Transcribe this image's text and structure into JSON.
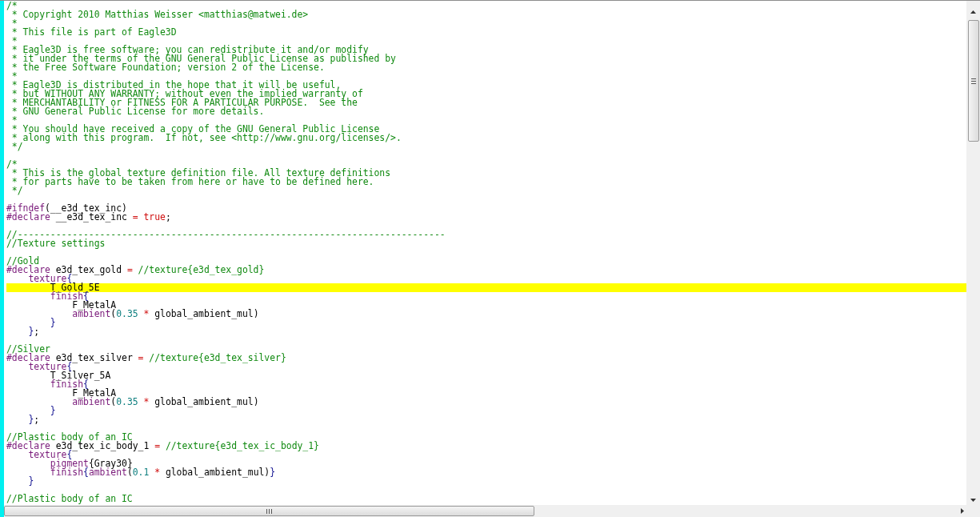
{
  "editor": {
    "lines": [
      {
        "current": false,
        "tokens": [
          {
            "kind": "comment",
            "text": "/*"
          }
        ]
      },
      {
        "current": false,
        "tokens": [
          {
            "kind": "comment",
            "text": " * Copyright 2010 Matthias Weisser <matthias@matwei.de>"
          }
        ]
      },
      {
        "current": false,
        "tokens": [
          {
            "kind": "comment",
            "text": " *"
          }
        ]
      },
      {
        "current": false,
        "tokens": [
          {
            "kind": "comment",
            "text": " * This file is part of Eagle3D"
          }
        ]
      },
      {
        "current": false,
        "tokens": [
          {
            "kind": "comment",
            "text": " *"
          }
        ]
      },
      {
        "current": false,
        "tokens": [
          {
            "kind": "comment",
            "text": " * Eagle3D is free software; you can redistribute it and/or modify"
          }
        ]
      },
      {
        "current": false,
        "tokens": [
          {
            "kind": "comment",
            "text": " * it under the terms of the GNU General Public License as published by"
          }
        ]
      },
      {
        "current": false,
        "tokens": [
          {
            "kind": "comment",
            "text": " * the Free Software Foundation; version 2 of the License."
          }
        ]
      },
      {
        "current": false,
        "tokens": [
          {
            "kind": "comment",
            "text": " *"
          }
        ]
      },
      {
        "current": false,
        "tokens": [
          {
            "kind": "comment",
            "text": " * Eagle3D is distributed in the hope that it will be useful,"
          }
        ]
      },
      {
        "current": false,
        "tokens": [
          {
            "kind": "comment",
            "text": " * but WITHOUT ANY WARRANTY; without even the implied warranty of"
          }
        ]
      },
      {
        "current": false,
        "tokens": [
          {
            "kind": "comment",
            "text": " * MERCHANTABILITY or FITNESS FOR A PARTICULAR PURPOSE.  See the"
          }
        ]
      },
      {
        "current": false,
        "tokens": [
          {
            "kind": "comment",
            "text": " * GNU General Public License for more details."
          }
        ]
      },
      {
        "current": false,
        "tokens": [
          {
            "kind": "comment",
            "text": " *"
          }
        ]
      },
      {
        "current": false,
        "tokens": [
          {
            "kind": "comment",
            "text": " * You should have received a copy of the GNU General Public License"
          }
        ]
      },
      {
        "current": false,
        "tokens": [
          {
            "kind": "comment",
            "text": " * along with this program.  If not, see <http://www.gnu.org/licenses/>."
          }
        ]
      },
      {
        "current": false,
        "tokens": [
          {
            "kind": "comment",
            "text": " */"
          }
        ]
      },
      {
        "current": false
      },
      {
        "current": false,
        "tokens": [
          {
            "kind": "comment",
            "text": "/*"
          }
        ]
      },
      {
        "current": false,
        "tokens": [
          {
            "kind": "comment",
            "text": " * This is the global texture definition file. All texture definitions"
          }
        ]
      },
      {
        "current": false,
        "tokens": [
          {
            "kind": "comment",
            "text": " * for parts have to be taken from here or have to be defined here."
          }
        ]
      },
      {
        "current": false,
        "tokens": [
          {
            "kind": "comment",
            "text": " */"
          }
        ]
      },
      {
        "current": false
      },
      {
        "current": false,
        "tokens": [
          {
            "kind": "directive",
            "text": "#ifndef"
          },
          {
            "kind": "plain",
            "text": "(__e3d_tex_inc)"
          }
        ]
      },
      {
        "current": false,
        "tokens": [
          {
            "kind": "directive",
            "text": "#declare"
          },
          {
            "kind": "plain",
            "text": " __e3d_tex_inc "
          },
          {
            "kind": "operator",
            "text": "="
          },
          {
            "kind": "operator",
            "text": " true"
          },
          {
            "kind": "plain",
            "text": ";"
          }
        ]
      },
      {
        "current": false
      },
      {
        "current": false,
        "tokens": [
          {
            "kind": "comment",
            "text": "//------------------------------------------------------------------------------"
          }
        ]
      },
      {
        "current": false,
        "tokens": [
          {
            "kind": "comment",
            "text": "//Texture settings"
          }
        ]
      },
      {
        "current": false
      },
      {
        "current": false,
        "tokens": [
          {
            "kind": "comment",
            "text": "//Gold"
          }
        ]
      },
      {
        "current": false,
        "tokens": [
          {
            "kind": "directive",
            "text": "#declare"
          },
          {
            "kind": "plain",
            "text": " e3d_tex_gold "
          },
          {
            "kind": "operator",
            "text": "="
          },
          {
            "kind": "comment",
            "text": " //texture{e3d_tex_gold}"
          }
        ]
      },
      {
        "current": false,
        "tokens": [
          {
            "kind": "keyword",
            "text": "    texture"
          },
          {
            "kind": "brace",
            "text": "{"
          }
        ]
      },
      {
        "current": true,
        "tokens": [
          {
            "kind": "plain",
            "text": "        T_Gold_5E"
          }
        ]
      },
      {
        "current": false,
        "tokens": [
          {
            "kind": "keyword",
            "text": "        finish"
          },
          {
            "kind": "brace",
            "text": "{"
          }
        ]
      },
      {
        "current": false,
        "tokens": [
          {
            "kind": "plain",
            "text": "            F_MetalA"
          }
        ]
      },
      {
        "current": false,
        "tokens": [
          {
            "kind": "keyword",
            "text": "            ambient"
          },
          {
            "kind": "plain",
            "text": "("
          },
          {
            "kind": "number",
            "text": "0.35"
          },
          {
            "kind": "operator",
            "text": " *"
          },
          {
            "kind": "plain",
            "text": " global_ambient_mul)"
          }
        ]
      },
      {
        "current": false,
        "tokens": [
          {
            "kind": "brace",
            "text": "        }"
          }
        ]
      },
      {
        "current": false,
        "tokens": [
          {
            "kind": "brace",
            "text": "    }"
          },
          {
            "kind": "plain",
            "text": ";"
          }
        ]
      },
      {
        "current": false
      },
      {
        "current": false,
        "tokens": [
          {
            "kind": "comment",
            "text": "//Silver"
          }
        ]
      },
      {
        "current": false,
        "tokens": [
          {
            "kind": "directive",
            "text": "#declare"
          },
          {
            "kind": "plain",
            "text": " e3d_tex_silver "
          },
          {
            "kind": "operator",
            "text": "="
          },
          {
            "kind": "comment",
            "text": " //texture{e3d_tex_silver}"
          }
        ]
      },
      {
        "current": false,
        "tokens": [
          {
            "kind": "keyword",
            "text": "    texture"
          },
          {
            "kind": "brace",
            "text": "{"
          }
        ]
      },
      {
        "current": false,
        "tokens": [
          {
            "kind": "plain",
            "text": "        T_Silver_5A"
          }
        ]
      },
      {
        "current": false,
        "tokens": [
          {
            "kind": "keyword",
            "text": "        finish"
          },
          {
            "kind": "brace",
            "text": "{"
          }
        ]
      },
      {
        "current": false,
        "tokens": [
          {
            "kind": "plain",
            "text": "            F_MetalA"
          }
        ]
      },
      {
        "current": false,
        "tokens": [
          {
            "kind": "keyword",
            "text": "            ambient"
          },
          {
            "kind": "plain",
            "text": "("
          },
          {
            "kind": "number",
            "text": "0.35"
          },
          {
            "kind": "operator",
            "text": " *"
          },
          {
            "kind": "plain",
            "text": " global_ambient_mul)"
          }
        ]
      },
      {
        "current": false,
        "tokens": [
          {
            "kind": "brace",
            "text": "        }"
          }
        ]
      },
      {
        "current": false,
        "tokens": [
          {
            "kind": "brace",
            "text": "    }"
          },
          {
            "kind": "plain",
            "text": ";"
          }
        ]
      },
      {
        "current": false
      },
      {
        "current": false,
        "tokens": [
          {
            "kind": "comment",
            "text": "//Plastic body of an IC"
          }
        ]
      },
      {
        "current": false,
        "tokens": [
          {
            "kind": "directive",
            "text": "#declare"
          },
          {
            "kind": "plain",
            "text": " e3d_tex_ic_body_1 "
          },
          {
            "kind": "operator",
            "text": "="
          },
          {
            "kind": "comment",
            "text": " //texture{e3d_tex_ic_body_1}"
          }
        ]
      },
      {
        "current": false,
        "tokens": [
          {
            "kind": "keyword",
            "text": "    texture"
          },
          {
            "kind": "brace",
            "text": "{"
          }
        ]
      },
      {
        "current": false,
        "tokens": [
          {
            "kind": "keyword",
            "text": "        pigment"
          },
          {
            "kind": "plain",
            "text": "{Gray30}"
          }
        ]
      },
      {
        "current": false,
        "tokens": [
          {
            "kind": "keyword",
            "text": "        finish"
          },
          {
            "kind": "brace",
            "text": "{"
          },
          {
            "kind": "keyword",
            "text": "ambient"
          },
          {
            "kind": "plain",
            "text": "("
          },
          {
            "kind": "number",
            "text": "0.1"
          },
          {
            "kind": "operator",
            "text": " *"
          },
          {
            "kind": "plain",
            "text": " global_ambient_mul)"
          },
          {
            "kind": "brace",
            "text": "}"
          }
        ]
      },
      {
        "current": false,
        "tokens": [
          {
            "kind": "brace",
            "text": "    }"
          }
        ]
      },
      {
        "current": false
      },
      {
        "current": false,
        "tokens": [
          {
            "kind": "comment",
            "text": "//Plastic body of an IC"
          }
        ]
      }
    ]
  }
}
